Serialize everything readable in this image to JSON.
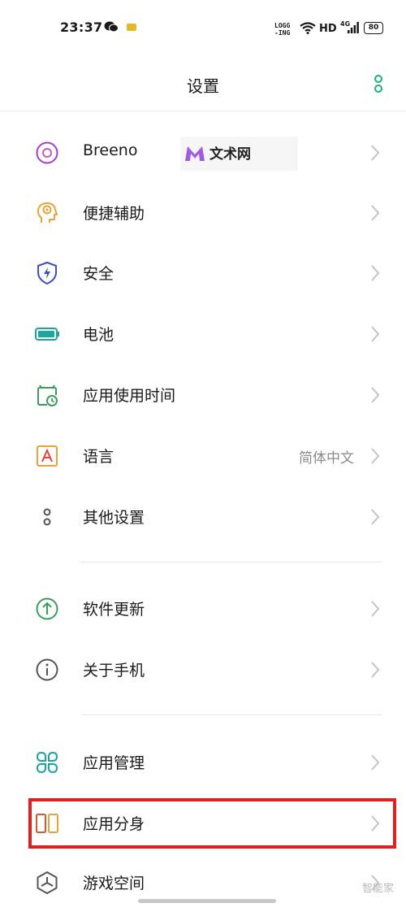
{
  "status_bar": {
    "time": "23:37",
    "logging_line1": "LOGG",
    "logging_line2": "-ING",
    "network": "HD",
    "net_type": "4G",
    "battery": "80"
  },
  "header": {
    "title": "设置"
  },
  "watermark": {
    "text": "文术网"
  },
  "settings": {
    "breeno": {
      "label": "Breeno"
    },
    "accessibility": {
      "label": "便捷辅助"
    },
    "security": {
      "label": "安全"
    },
    "battery": {
      "label": "电池"
    },
    "app_usage_time": {
      "label": "应用使用时间"
    },
    "language": {
      "label": "语言",
      "value": "简体中文"
    },
    "other_settings": {
      "label": "其他设置"
    },
    "software_update": {
      "label": "软件更新"
    },
    "about_phone": {
      "label": "关于手机"
    },
    "app_management": {
      "label": "应用管理"
    },
    "app_clone": {
      "label": "应用分身"
    },
    "game_space": {
      "label": "游戏空间"
    }
  },
  "corner_mark": "智能家",
  "colors": {
    "accent_green": "#1bb27a",
    "highlight_red": "#e01f1f",
    "breeno_purple": "#a33fcf",
    "accessibility_orange": "#e8a33c",
    "security_blue": "#3d4fc0",
    "battery_teal": "#1ba7a0"
  }
}
